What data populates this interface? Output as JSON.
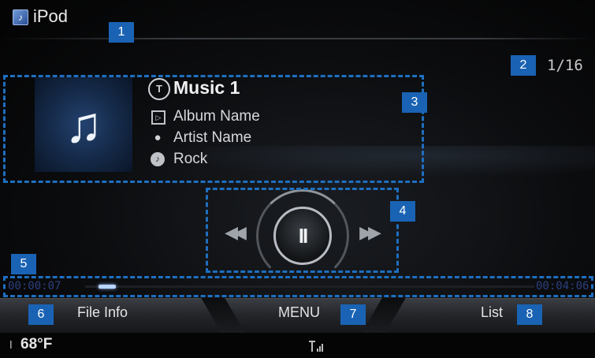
{
  "header": {
    "app_icon": "music-note-icon",
    "title": "iPod"
  },
  "track_counter": "1/16",
  "now_playing": {
    "album_art_icon": "music-note-icon",
    "title": "Music 1",
    "title_icon": "title-icon",
    "album": "Album Name",
    "album_icon": "album-icon",
    "artist": "Artist Name",
    "artist_icon": "artist-icon",
    "genre": "Rock",
    "genre_icon": "genre-icon"
  },
  "controls": {
    "prev_icon": "previous-track-icon",
    "pause_icon": "pause-icon",
    "next_icon": "next-track-icon"
  },
  "progress": {
    "elapsed": "00:00:07",
    "total": "00:04:06",
    "fraction": 0.03
  },
  "bottom_bar": {
    "file_info": "File Info",
    "menu": "MENU",
    "list": "List"
  },
  "status": {
    "temperature": "68°F",
    "thermometer_icon": "thermometer-icon",
    "signal_icon": "signal-strength-icon"
  },
  "callouts": [
    "1",
    "2",
    "3",
    "4",
    "5",
    "6",
    "7",
    "8"
  ],
  "colors": {
    "callout": "#1e6fc0",
    "badge": "#1a63b4",
    "progress_fill": "#b9d4ff",
    "time_text": "#2d3f7f"
  }
}
